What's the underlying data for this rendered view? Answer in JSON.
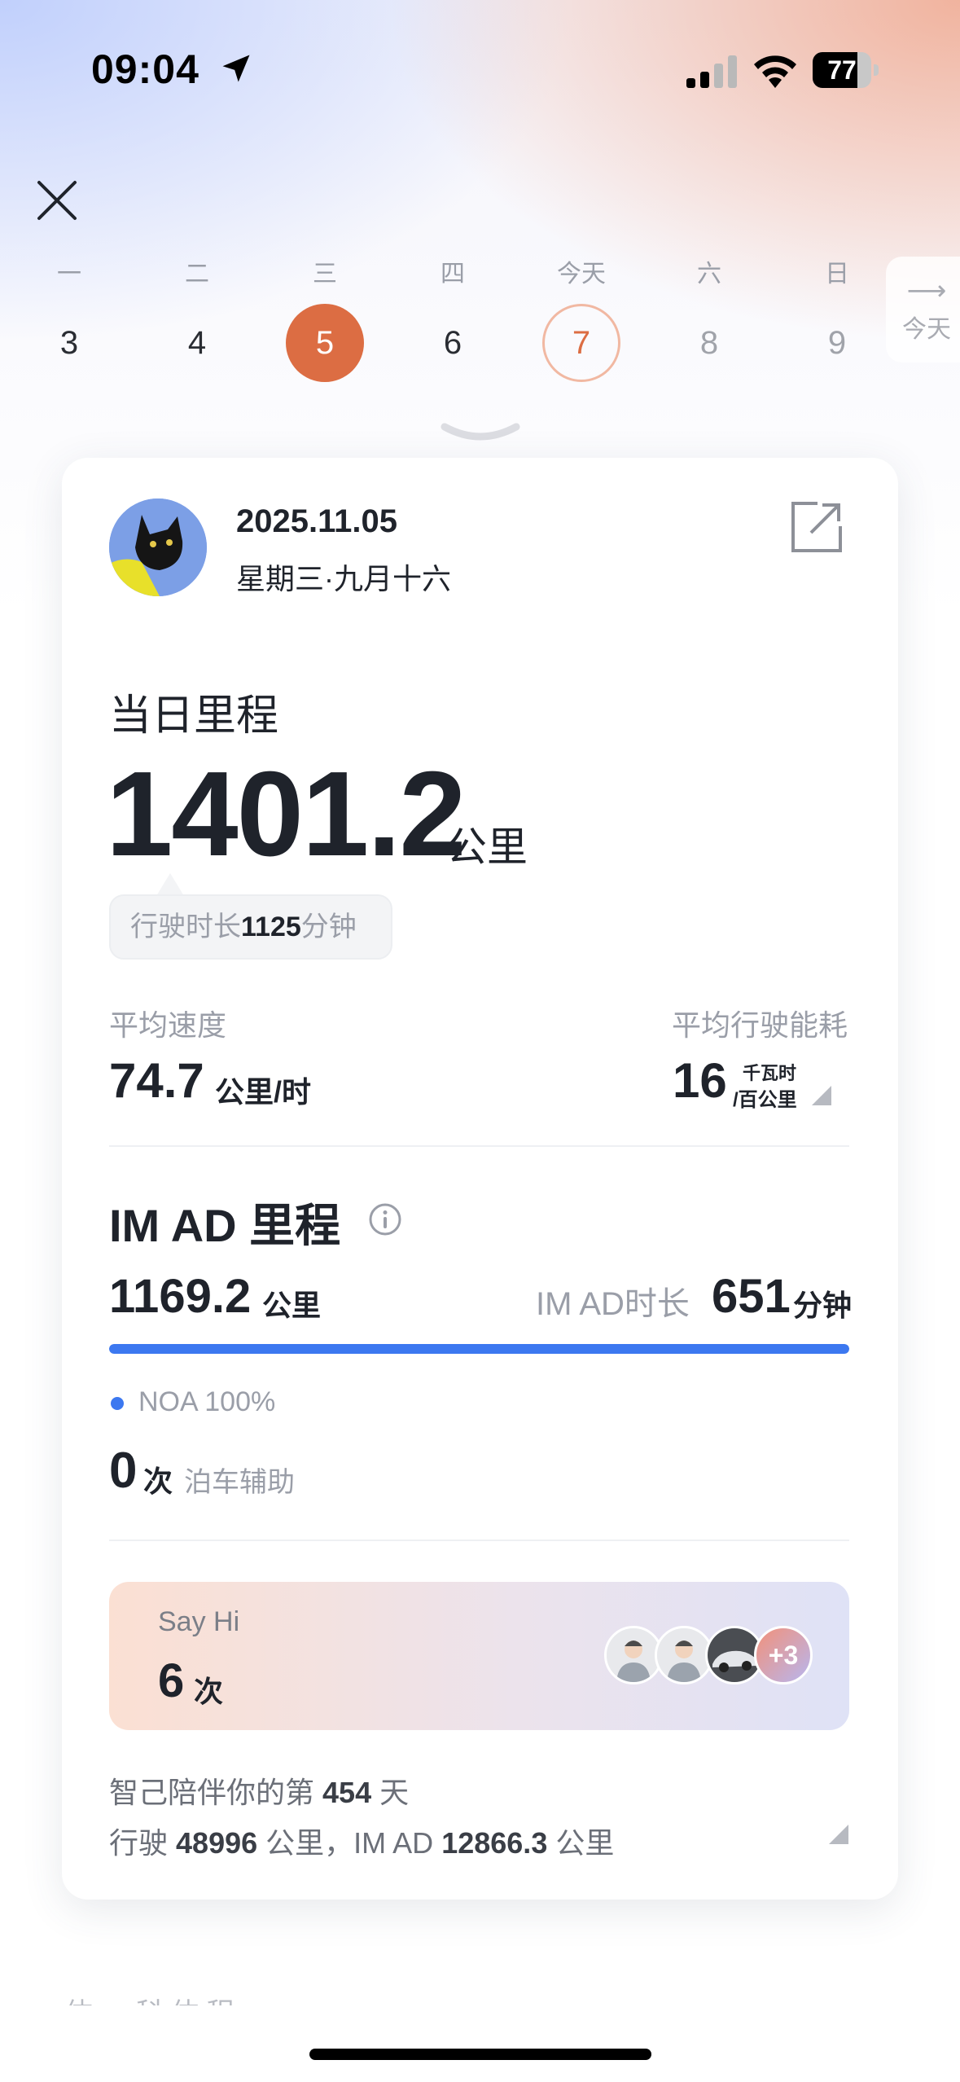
{
  "status_bar": {
    "time": "09:04",
    "battery": "77",
    "battery_level": 0.77
  },
  "calendar": {
    "days": [
      {
        "weekday": "一",
        "date": "3",
        "state": "normal"
      },
      {
        "weekday": "二",
        "date": "4",
        "state": "normal"
      },
      {
        "weekday": "三",
        "date": "5",
        "state": "selected"
      },
      {
        "weekday": "四",
        "date": "6",
        "state": "normal"
      },
      {
        "weekday": "今天",
        "date": "7",
        "state": "today"
      },
      {
        "weekday": "六",
        "date": "8",
        "state": "future"
      },
      {
        "weekday": "日",
        "date": "9",
        "state": "future"
      }
    ],
    "today_button": "今天"
  },
  "card": {
    "date": "2025.11.05",
    "weekday_lunar": "星期三·九月十六",
    "daily": {
      "title": "当日里程",
      "value": "1401.2",
      "unit": "公里",
      "duration_prefix": "行驶时长",
      "duration_value": "1125",
      "duration_unit": "分钟"
    },
    "avg_speed": {
      "label": "平均速度",
      "value": "74.7",
      "unit": "公里/时"
    },
    "avg_consumption": {
      "label": "平均行驶能耗",
      "value": "16",
      "unit_top": "千瓦时",
      "unit_bottom": "/百公里"
    },
    "imad": {
      "title": "IM AD 里程",
      "value": "1169.2",
      "unit": "公里",
      "time_label": "IM AD时长",
      "time_value": "651",
      "time_unit": "分钟",
      "progress": 1.0,
      "noa_label": "NOA 100%",
      "parking_value": "0",
      "parking_unit": "次",
      "parking_label": "泊车辅助"
    },
    "sayhi": {
      "label": "Say Hi",
      "value": "6",
      "unit": "次",
      "more": "+3"
    },
    "companion": {
      "line1_prefix": "智己陪伴你的第",
      "days": "454",
      "line1_suffix": "天",
      "line2_prefix": "行驶",
      "total_km": "48996",
      "line2_mid": "公里，IM AD",
      "imad_km": "12866.3",
      "line2_suffix": "公里"
    }
  },
  "footer_text": "体 一 科 体 程",
  "colors": {
    "accent_orange": "#dc6d43",
    "progress_blue": "#3c78f0",
    "text_dark": "#1f232b",
    "text_gray": "#9a9ea8"
  }
}
